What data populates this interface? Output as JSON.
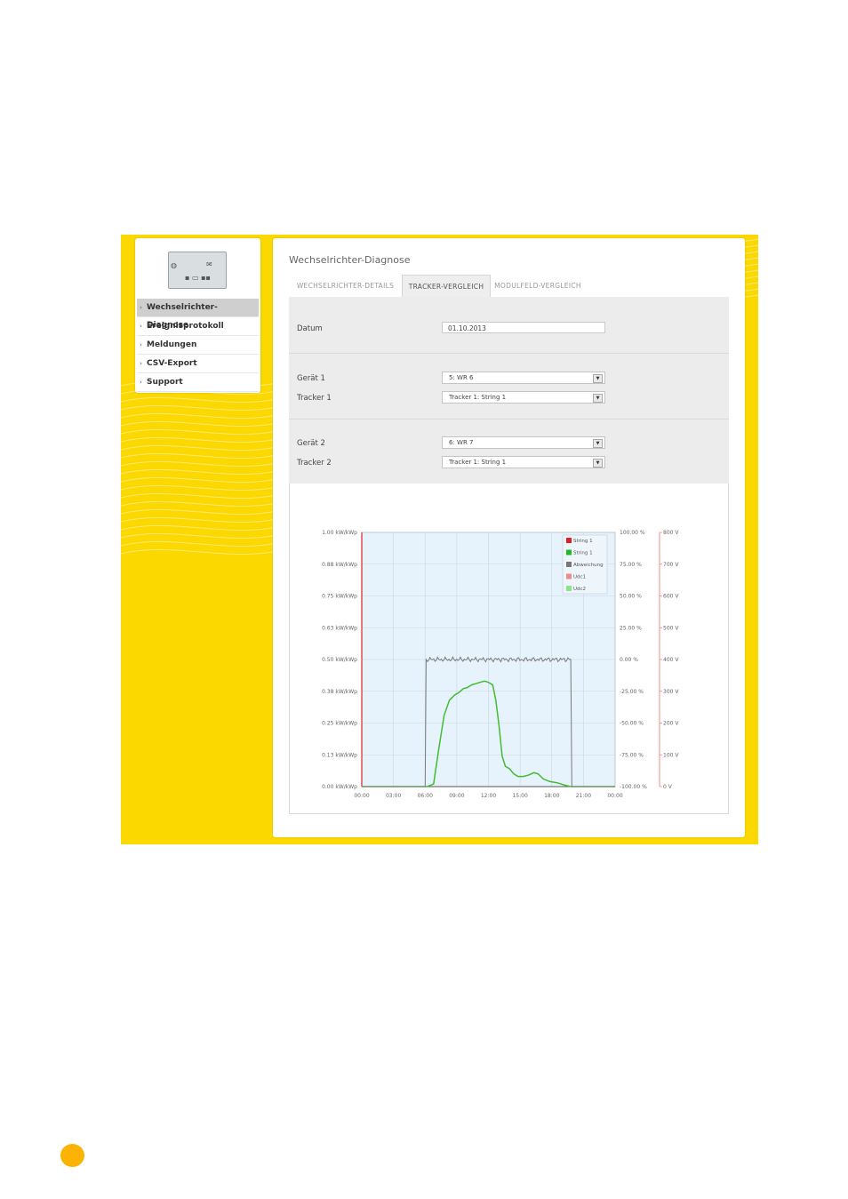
{
  "sidebar": {
    "nav": [
      {
        "label": "Wechselrichter-Diagnose",
        "active": true
      },
      {
        "label": "Ereignisprotokoll",
        "active": false
      },
      {
        "label": "Meldungen",
        "active": false
      },
      {
        "label": "CSV-Export",
        "active": false
      },
      {
        "label": "Support",
        "active": false
      }
    ]
  },
  "panel": {
    "title": "Wechselrichter-Diagnose",
    "tabs": [
      {
        "label": "WECHSELRICHTER-DETAILS",
        "active": false
      },
      {
        "label": "TRACKER-VERGLEICH",
        "active": true
      },
      {
        "label": "MODULFELD-VERGLEICH",
        "active": false
      }
    ],
    "form": {
      "date_label": "Datum",
      "date_value": "01.10.2013",
      "device1_label": "Gerät 1",
      "device1_value": "5: WR 6",
      "tracker1_label": "Tracker 1",
      "tracker1_value": "Tracker 1: String 1",
      "device2_label": "Gerät 2",
      "device2_value": "6: WR 7",
      "tracker2_label": "Tracker 2",
      "tracker2_value": "Tracker 1: String 1"
    }
  },
  "chart_data": {
    "type": "line",
    "x_ticks": [
      "00:00",
      "03:00",
      "06:00",
      "09:00",
      "12:00",
      "15:00",
      "18:00",
      "21:00",
      "00:00"
    ],
    "y_left_ticks": [
      "0.00 kW/kWp",
      "0.13 kW/kWp",
      "0.25 kW/kWp",
      "0.38 kW/kWp",
      "0.50 kW/kWp",
      "0.63 kW/kWp",
      "0.75 kW/kWp",
      "0.88 kW/kWp",
      "1.00 kW/kWp"
    ],
    "y_mid_ticks": [
      "-100.00 %",
      "-75.00 %",
      "-50.00 %",
      "-25.00 %",
      "0.00 %",
      "25.00 %",
      "50.00 %",
      "75.00 %",
      "100.00 %"
    ],
    "y_right_ticks": [
      "0 V",
      "100 V",
      "200 V",
      "300 V",
      "400 V",
      "500 V",
      "600 V",
      "700 V",
      "800 V"
    ],
    "legend": [
      {
        "name": "String 1",
        "color": "#e02020"
      },
      {
        "name": "String 1",
        "color": "#22bb22"
      },
      {
        "name": "Abweichung",
        "color": "#777777"
      },
      {
        "name": "Udc1",
        "color": "#f08a8a"
      },
      {
        "name": "Udc2",
        "color": "#8fe08f"
      }
    ],
    "series": [
      {
        "name": "String 1",
        "color": "#44bb33",
        "axis": "kW/kWp",
        "points": [
          [
            0,
            0
          ],
          [
            6.2,
            0
          ],
          [
            6.8,
            0.01
          ],
          [
            7.3,
            0.15
          ],
          [
            7.8,
            0.28
          ],
          [
            8.3,
            0.34
          ],
          [
            8.8,
            0.36
          ],
          [
            9.2,
            0.37
          ],
          [
            9.6,
            0.385
          ],
          [
            10.0,
            0.39
          ],
          [
            10.4,
            0.4
          ],
          [
            10.8,
            0.405
          ],
          [
            11.2,
            0.41
          ],
          [
            11.6,
            0.415
          ],
          [
            12.0,
            0.41
          ],
          [
            12.4,
            0.4
          ],
          [
            12.7,
            0.34
          ],
          [
            13.0,
            0.24
          ],
          [
            13.3,
            0.12
          ],
          [
            13.6,
            0.08
          ],
          [
            14.0,
            0.07
          ],
          [
            14.4,
            0.05
          ],
          [
            14.8,
            0.04
          ],
          [
            15.3,
            0.04
          ],
          [
            15.8,
            0.045
          ],
          [
            16.3,
            0.055
          ],
          [
            16.7,
            0.05
          ],
          [
            17.2,
            0.03
          ],
          [
            17.8,
            0.02
          ],
          [
            18.5,
            0.015
          ],
          [
            19.3,
            0.005
          ],
          [
            19.8,
            0
          ],
          [
            24,
            0
          ]
        ]
      },
      {
        "name": "Abweichung",
        "color": "#7a7a7a",
        "axis": "%",
        "points": [
          [
            0,
            -100
          ],
          [
            6.0,
            -100
          ],
          [
            6.1,
            0
          ],
          [
            19.8,
            0
          ],
          [
            19.9,
            -100
          ],
          [
            24,
            -100
          ]
        ]
      }
    ],
    "xlim": [
      "00:00",
      "24:00"
    ],
    "ylim_left": [
      0,
      1.0
    ],
    "ylim_mid": [
      -100,
      100
    ],
    "ylim_right": [
      0,
      800
    ],
    "legend_position": "top-right",
    "grid": true
  }
}
